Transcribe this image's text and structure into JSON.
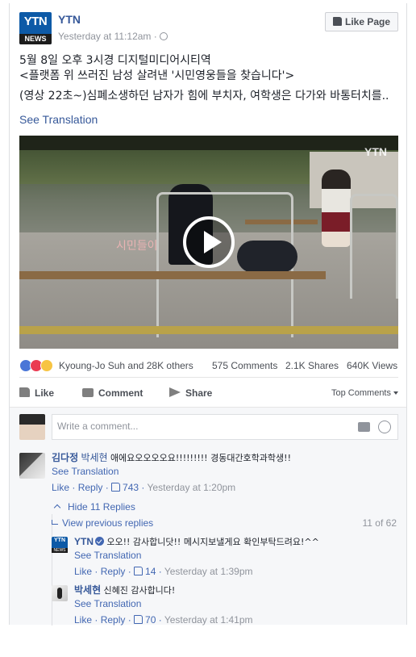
{
  "post": {
    "page_name": "YTN",
    "logo_text": "YTN",
    "logo_subtext": "NEWS",
    "timestamp": "Yesterday at 11:12am",
    "like_page_label": "Like Page",
    "text_line1": "5월 8일 오후 3시경 디지털미디어시티역",
    "text_line2": "<플랫폼 위 쓰러진 남성 살려낸 '시민영웅들을 찾습니다'>",
    "text_line3": "(영상 22초~)심폐소생하던 남자가 힘에 부치자, 여학생은 다가와 바통터치를..",
    "see_translation": "See Translation",
    "video_watermark": "YTN",
    "video_caption": "시민들이"
  },
  "stats": {
    "reactions_names": "Kyoung-Jo Suh and 28K others",
    "comments": "575 Comments",
    "shares": "2.1K Shares",
    "views": "640K Views"
  },
  "actions": {
    "like": "Like",
    "comment": "Comment",
    "share": "Share",
    "sort": "Top Comments"
  },
  "composer": {
    "placeholder": "Write a comment..."
  },
  "comments": {
    "c1": {
      "name": "김다정",
      "tag": "박세현",
      "text": "애에요오오오오요!!!!!!!!! 경동대간호학과학생!!",
      "see_translation": "See Translation",
      "like": "Like",
      "reply": "Reply",
      "likes": "743",
      "time": "Yesterday at 1:20pm"
    },
    "hide_replies": "Hide 11 Replies",
    "view_previous": "View previous replies",
    "counter": "11 of 62",
    "r1": {
      "name": "YTN",
      "text": "오오!! 감사합니닷!! 메시지보낼게요 확인부탁드려요!^^",
      "see_translation": "See Translation",
      "like": "Like",
      "reply": "Reply",
      "likes": "14",
      "time": "Yesterday at 1:39pm"
    },
    "r2": {
      "name": "박세현",
      "text": "신혜진 감사합니다!",
      "see_translation": "See Translation",
      "like": "Like",
      "reply": "Reply",
      "likes": "70",
      "time": "Yesterday at 1:41pm"
    }
  },
  "colors": {
    "link": "#365899",
    "accent": "#4267b2",
    "ytn_blue": "#0d5aa7"
  }
}
